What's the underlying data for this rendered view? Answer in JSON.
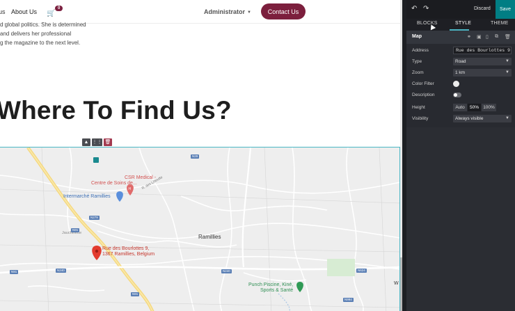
{
  "nav": {
    "partial_link": "us",
    "about_label": "About Us",
    "cart_count": "0",
    "admin_label": "Administrator",
    "contact_label": "Contact Us"
  },
  "intro": {
    "lines": [
      "d global politics. She is determined",
      "and delivers her professional",
      "g the magazine to the next level."
    ]
  },
  "heading": "Where To Find Us?",
  "map": {
    "labels": {
      "csr": "CSR Medical -",
      "csr2": "Centre de Soins de...",
      "intermarche": "Intermarché Ramillies",
      "ramillies": "Ramillies",
      "pin_line1": "Rue des Bourlottes 9,",
      "pin_line2": "1367 Ramillies, Belgium",
      "punch1": "Punch Piscine, Kiné,",
      "punch2": "Sports & Santé",
      "jauche": "Jauchelette",
      "rue_bas": "R. des Liboutte",
      "w_label": "W"
    },
    "shields": [
      "N29",
      "N279",
      "N91",
      "N91",
      "N240",
      "N91",
      "N240",
      "N624",
      "N994"
    ]
  },
  "editor": {
    "discard_label": "Discard",
    "save_label": "Save",
    "tabs": [
      "BLOCKS",
      "STYLE",
      "THEME"
    ],
    "section_title": "Map",
    "options": {
      "address_label": "Address",
      "address_value": "Rue des Bourlottes 9",
      "type_label": "Type",
      "type_value": "Road",
      "zoom_label": "Zoom",
      "zoom_value": "1 km",
      "color_filter_label": "Color Filter",
      "description_label": "Description",
      "height_label": "Height",
      "height_options": [
        "Auto",
        "50%",
        "100%"
      ],
      "height_selected": "50%",
      "visibility_label": "Visibility",
      "visibility_value": "Always visible"
    }
  },
  "colors": {
    "brand": "#7c1f3d",
    "editor_bg": "#282a30",
    "save": "#017e84",
    "accent": "#4bb3c1"
  }
}
